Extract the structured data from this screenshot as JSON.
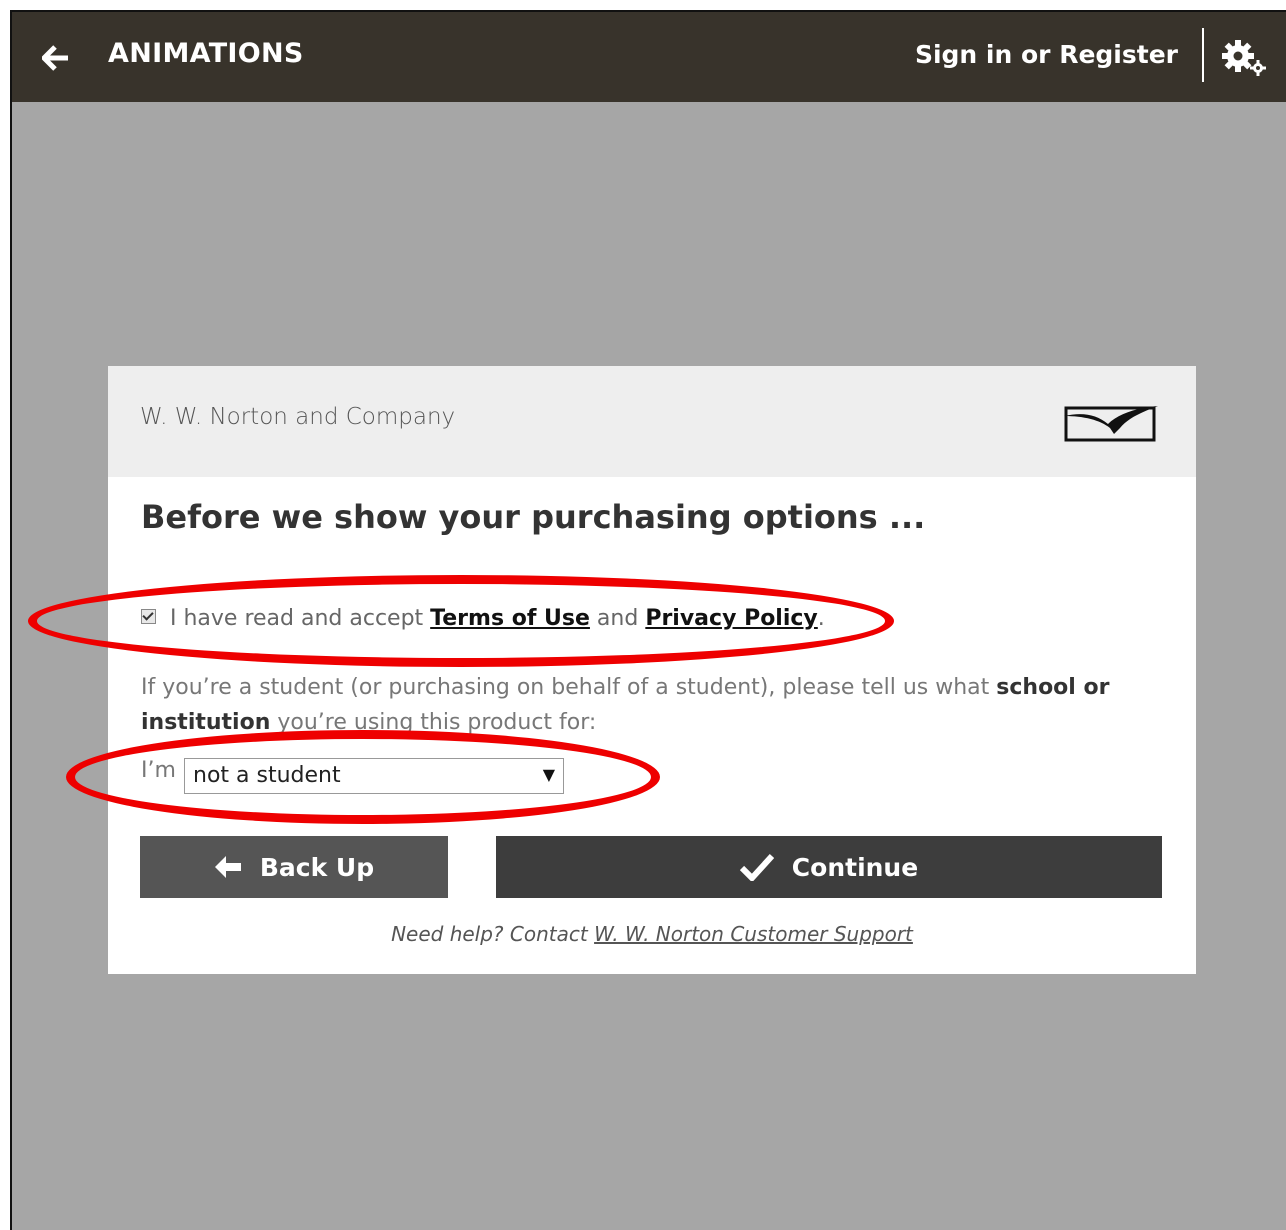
{
  "topbar": {
    "title": "ANIMATIONS",
    "sign_in_label": "Sign in or Register"
  },
  "card": {
    "company": "W. W. Norton and Company",
    "heading": "Before we show your purchasing options ...",
    "terms": {
      "checked": true,
      "prefix": "I have read and accept ",
      "terms_link": "Terms of Use",
      "middle": " and ",
      "privacy_link": "Privacy Policy",
      "suffix": "."
    },
    "student_prompt": {
      "before": "If you’re a student (or purchasing on behalf of a student), please tell us what ",
      "emphasis": "school or institution",
      "after": " you’re using this product for:"
    },
    "im_label": "I’m",
    "student_select_value": "not a student",
    "back_button": "Back Up",
    "continue_button": "Continue",
    "help": {
      "prefix": "Need help? Contact ",
      "link": "W. W. Norton Customer Support"
    }
  },
  "annotation_color": "#ee0000"
}
